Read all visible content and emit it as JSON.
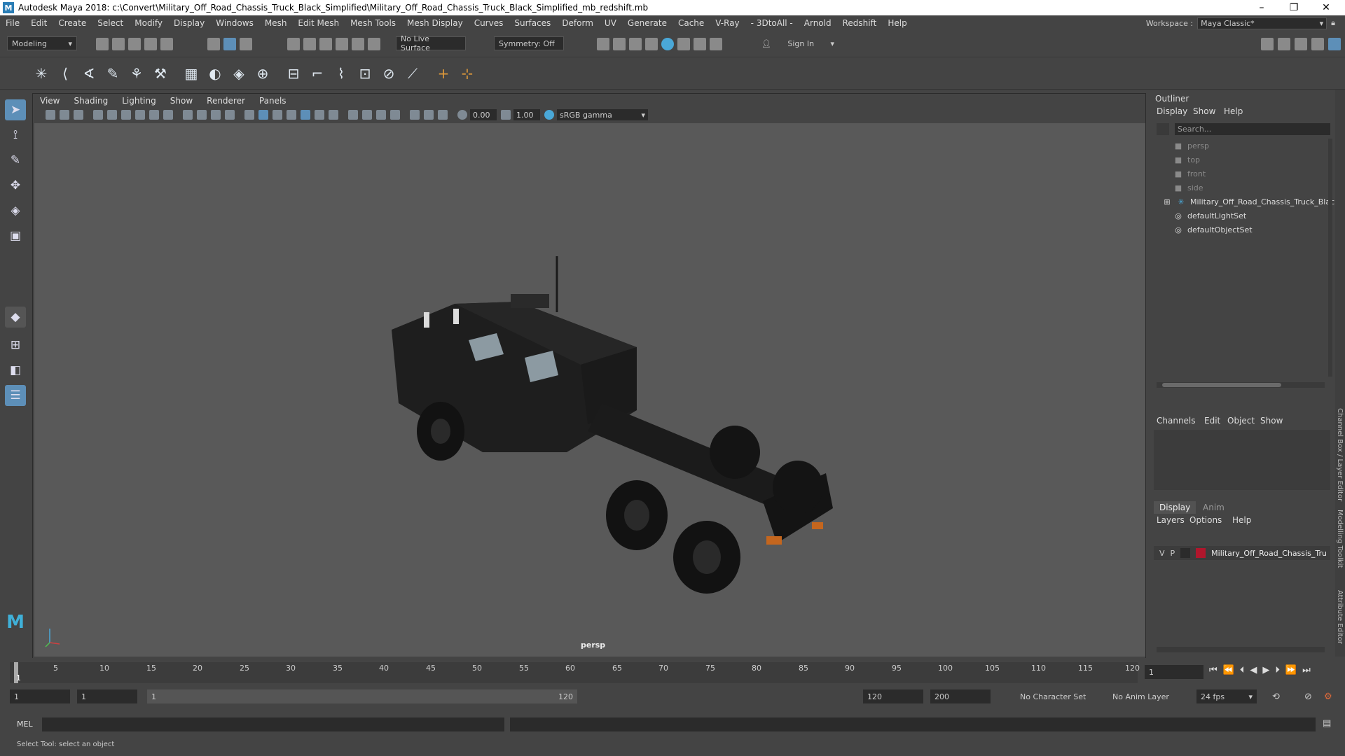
{
  "window": {
    "title": "Autodesk Maya 2018: c:\\Convert\\Military_Off_Road_Chassis_Truck_Black_Simplified\\Military_Off_Road_Chassis_Truck_Black_Simplified_mb_redshift.mb",
    "logo_letter": "M"
  },
  "menubar": {
    "items": [
      "File",
      "Edit",
      "Create",
      "Select",
      "Modify",
      "Display",
      "Windows",
      "Mesh",
      "Edit Mesh",
      "Mesh Tools",
      "Mesh Display",
      "Curves",
      "Surfaces",
      "Deform",
      "UV",
      "Generate",
      "Cache",
      "V-Ray",
      "- 3DtoAll -",
      "Arnold",
      "Redshift",
      "Help"
    ],
    "workspace_label": "Workspace :",
    "workspace_value": "Maya Classic*"
  },
  "statusline": {
    "mode": "Modeling",
    "live_surface": "No Live Surface",
    "symmetry": "Symmetry: Off",
    "sign_in": "Sign In"
  },
  "viewport": {
    "menu": [
      "View",
      "Shading",
      "Lighting",
      "Show",
      "Renderer",
      "Panels"
    ],
    "exposure": "0.00",
    "gamma": "1.00",
    "color_space": "sRGB gamma",
    "camera": "persp"
  },
  "outliner": {
    "title": "Outliner",
    "menu": [
      "Display",
      "Show",
      "Help"
    ],
    "search_placeholder": "Search...",
    "items": [
      {
        "label": "persp",
        "icon": "camera-icon",
        "dim": true
      },
      {
        "label": "top",
        "icon": "camera-icon",
        "dim": true
      },
      {
        "label": "front",
        "icon": "camera-icon",
        "dim": true
      },
      {
        "label": "side",
        "icon": "camera-icon",
        "dim": true
      },
      {
        "label": "Military_Off_Road_Chassis_Truck_Black_S",
        "icon": "transform-icon",
        "dim": false
      },
      {
        "label": "defaultLightSet",
        "icon": "set-icon",
        "dim": false
      },
      {
        "label": "defaultObjectSet",
        "icon": "set-icon",
        "dim": false
      }
    ]
  },
  "channelbox": {
    "menu": [
      "Channels",
      "Edit",
      "Object",
      "Show"
    ]
  },
  "layers": {
    "tabs": [
      "Display",
      "Anim"
    ],
    "menu": [
      "Layers",
      "Options",
      "Help"
    ],
    "layer": {
      "v": "V",
      "p": "P",
      "name": "Military_Off_Road_Chassis_Tru",
      "color": "#b0162c"
    }
  },
  "sidestrip": [
    "Channel Box / Layer Editor",
    "Modelling Toolkit",
    "Attribute Editor"
  ],
  "timeline": {
    "ticks": [
      "5",
      "10",
      "15",
      "20",
      "25",
      "30",
      "35",
      "40",
      "45",
      "50",
      "55",
      "60",
      "65",
      "70",
      "75",
      "80",
      "85",
      "90",
      "95",
      "100",
      "105",
      "110",
      "115",
      "120"
    ],
    "current_marker": "1",
    "current_frame": "1"
  },
  "range": {
    "start": "1",
    "anim_start": "1",
    "slider_start": "1",
    "slider_end": "120",
    "end": "120",
    "anim_end": "200",
    "character_set": "No Character Set",
    "anim_layer": "No Anim Layer",
    "fps": "24 fps"
  },
  "cmdline": {
    "label": "MEL"
  },
  "helpline": {
    "text": "Select Tool: select an object"
  }
}
